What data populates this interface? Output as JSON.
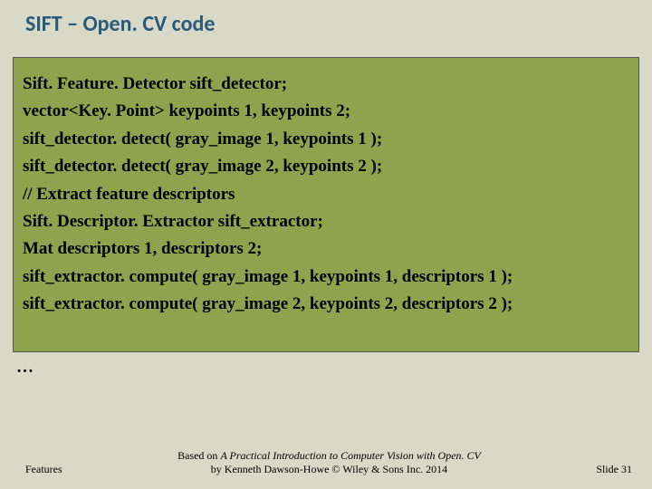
{
  "title": "SIFT – Open. CV code",
  "code": {
    "l1": "Sift. Feature. Detector sift_detector;",
    "l2": "vector<Key. Point> keypoints 1, keypoints 2;",
    "l3": "sift_detector. detect( gray_image 1, keypoints 1 );",
    "l4": "sift_detector. detect( gray_image 2, keypoints 2 );",
    "l5": "// Extract feature descriptors",
    "l6": "Sift. Descriptor. Extractor sift_extractor;",
    "l7": "Mat descriptors 1, descriptors 2;",
    "l8": "sift_extractor. compute( gray_image 1, keypoints 1, descriptors 1 );",
    "l9": "sift_extractor. compute( gray_image 2, keypoints 2, descriptors 2 );"
  },
  "ellipsis": "…",
  "footer": {
    "left": "Features",
    "center_prefix": "Based on ",
    "center_book": "A Practical Introduction to Computer Vision with Open. CV",
    "center_suffix": " by Kenneth Dawson-Howe © Wiley & Sons Inc. 2014",
    "right": "Slide 31"
  }
}
